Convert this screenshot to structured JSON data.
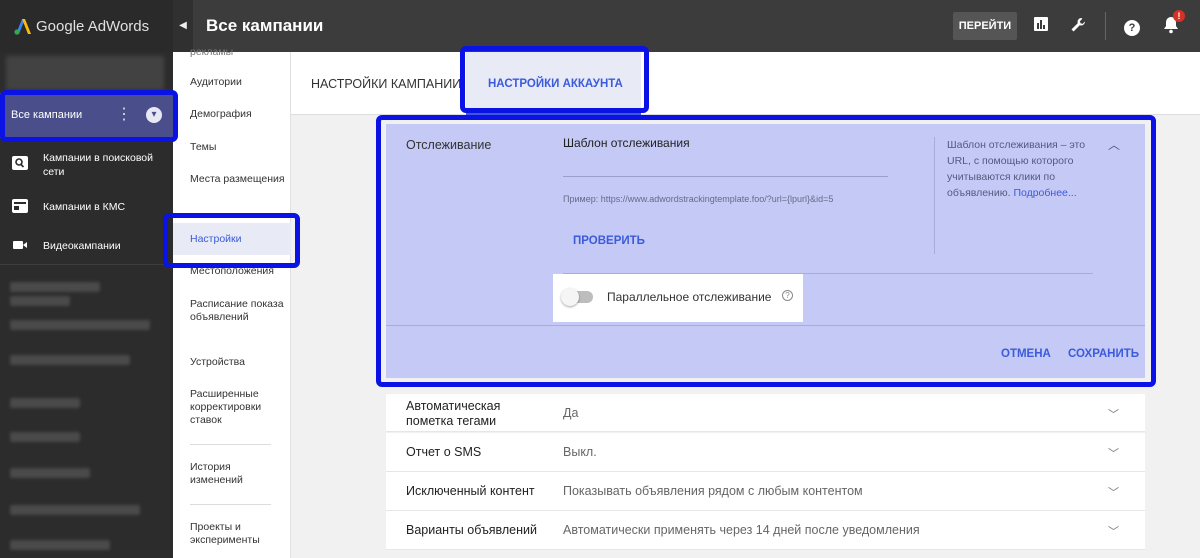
{
  "app": {
    "name": "Google AdWords"
  },
  "sidebar": {
    "all_campaigns_label": "Все кампании",
    "items": [
      {
        "label": "Кампании в поисковой сети",
        "icon": "search-icon"
      },
      {
        "label": "Кампании в КМС",
        "icon": "display-icon"
      },
      {
        "label": "Видеокампании",
        "icon": "video-icon"
      }
    ]
  },
  "header": {
    "title": "Все кампании",
    "goto_label": "ПЕРЕЙТИ",
    "notification_badge": "!"
  },
  "submenu": {
    "partial_top": "рекламы",
    "items": [
      "Аудитории",
      "Демография",
      "Темы",
      "Места размещения",
      "Настройки",
      "Местоположения",
      "Расписание показа объявлений",
      "Устройства",
      "Расширенные корректировки ставок",
      "История изменений",
      "Проекты и эксперименты"
    ],
    "active_item": "Настройки"
  },
  "tabs": {
    "campaign_settings": "НАСТРОЙКИ КАМПАНИИ",
    "account_settings": "НАСТРОЙКИ АККАУНТА"
  },
  "tracking": {
    "section_label": "Отслеживание",
    "template_label": "Шаблон отслеживания",
    "example": "Пример: https://www.adwordstrackingtemplate.foo/?url={lpurl}&id=5",
    "verify_label": "ПРОВЕРИТЬ",
    "help_text": "Шаблон отслеживания – это URL, с помощью которого учитываются клики по объявлению.",
    "help_link": "Подробнее...",
    "parallel_label": "Параллельное отслеживание",
    "cancel_label": "ОТМЕНА",
    "save_label": "СОХРАНИТЬ"
  },
  "settings_rows": [
    {
      "name": "Автоматическая пометка тегами",
      "value": "Да"
    },
    {
      "name": "Отчет о SMS",
      "value": "Выкл."
    },
    {
      "name": "Исключенный контент",
      "value": "Показывать объявления рядом с любым контентом"
    },
    {
      "name": "Варианты объявлений",
      "value": "Автоматически применять через 14 дней после уведомления"
    }
  ],
  "colors": {
    "highlight": "#0b12e6",
    "accent": "#3b5bdb",
    "panel_highlight": "#c5c9f5"
  }
}
